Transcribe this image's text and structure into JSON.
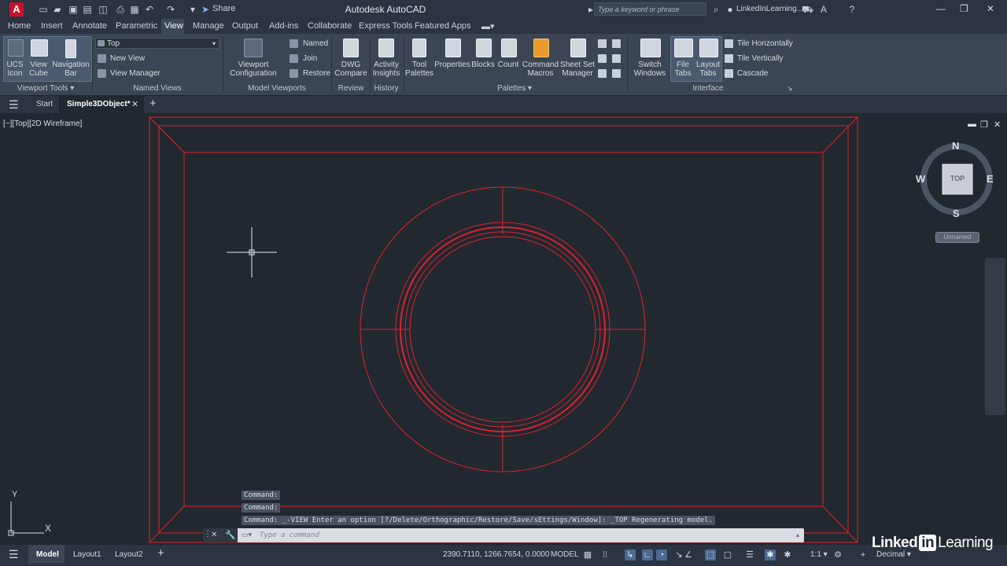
{
  "title_bar": {
    "logo": "A",
    "share_label": "Share",
    "app_title": "Autodesk AutoCAD",
    "search_placeholder": "Type a keyword or phrase",
    "user_label": "LinkedInLearning..."
  },
  "ribbon_tabs": [
    "Home",
    "Insert",
    "Annotate",
    "Parametric",
    "View",
    "Manage",
    "Output",
    "Add-ins",
    "Collaborate",
    "Express Tools",
    "Featured Apps"
  ],
  "active_tab": "View",
  "ribbon": {
    "viewport_tools": {
      "title": "Viewport Tools",
      "ucs_icon": "UCS",
      "ucs_icon2": "Icon",
      "view_cube": "View",
      "view_cube2": "Cube",
      "navigation_bar": "Navigation",
      "navigation_bar2": "Bar"
    },
    "named_views": {
      "title": "Named Views",
      "current": "Top",
      "new_view": "New View",
      "view_manager": "View Manager"
    },
    "model_viewports": {
      "title": "Model Viewports",
      "viewport_config": "Viewport",
      "viewport_config2": "Configuration",
      "named": "Named",
      "join": "Join",
      "restore": "Restore"
    },
    "review": {
      "title": "Review",
      "dwg_compare": "DWG",
      "dwg_compare2": "Compare"
    },
    "history": {
      "title": "History",
      "activity_insights": "Activity",
      "activity_insights2": "Insights"
    },
    "palettes": {
      "title": "Palettes",
      "tool_palettes": "Tool",
      "tool_palettes2": "Palettes",
      "properties": "Properties",
      "blocks": "Blocks",
      "count": "Count",
      "command_macros": "Command",
      "command_macros2": "Macros",
      "sheet_set": "Sheet Set",
      "sheet_set2": "Manager"
    },
    "interface": {
      "title": "Interface",
      "switch_windows": "Switch",
      "switch_windows2": "Windows",
      "file_tabs": "File",
      "file_tabs2": "Tabs",
      "layout_tabs": "Layout",
      "layout_tabs2": "Tabs",
      "tile_h": "Tile Horizontally",
      "tile_v": "Tile Vertically",
      "cascade": "Cascade"
    }
  },
  "file_tabs": {
    "start": "Start",
    "document": "Simple3DObject*"
  },
  "viewport_label": "[−][Top][2D Wireframe]",
  "compass": {
    "n": "N",
    "s": "S",
    "e": "E",
    "w": "W",
    "face": "TOP",
    "ucs": "Unnamed"
  },
  "ucs_axes": {
    "x": "X",
    "y": "Y"
  },
  "command_history": [
    "Command:",
    "Command:",
    "Command: _-VIEW Enter an option [?/Delete/Orthographic/Restore/Save/sEttings/Window]: _TOP Regenerating model."
  ],
  "command_placeholder": "Type a command",
  "status": {
    "model_tab": "Model",
    "layout1": "Layout1",
    "layout2": "Layout2",
    "coords": "2390.7110, 1266.7654, 0.0000",
    "space": "MODEL",
    "scale": "1:1",
    "units": "Decimal"
  },
  "watermark": {
    "left": "Linked",
    "in": "in",
    "right": "Learning"
  },
  "colors": {
    "geometry": "#e3222d",
    "background": "#212830",
    "ribbon": "#3b4553"
  }
}
